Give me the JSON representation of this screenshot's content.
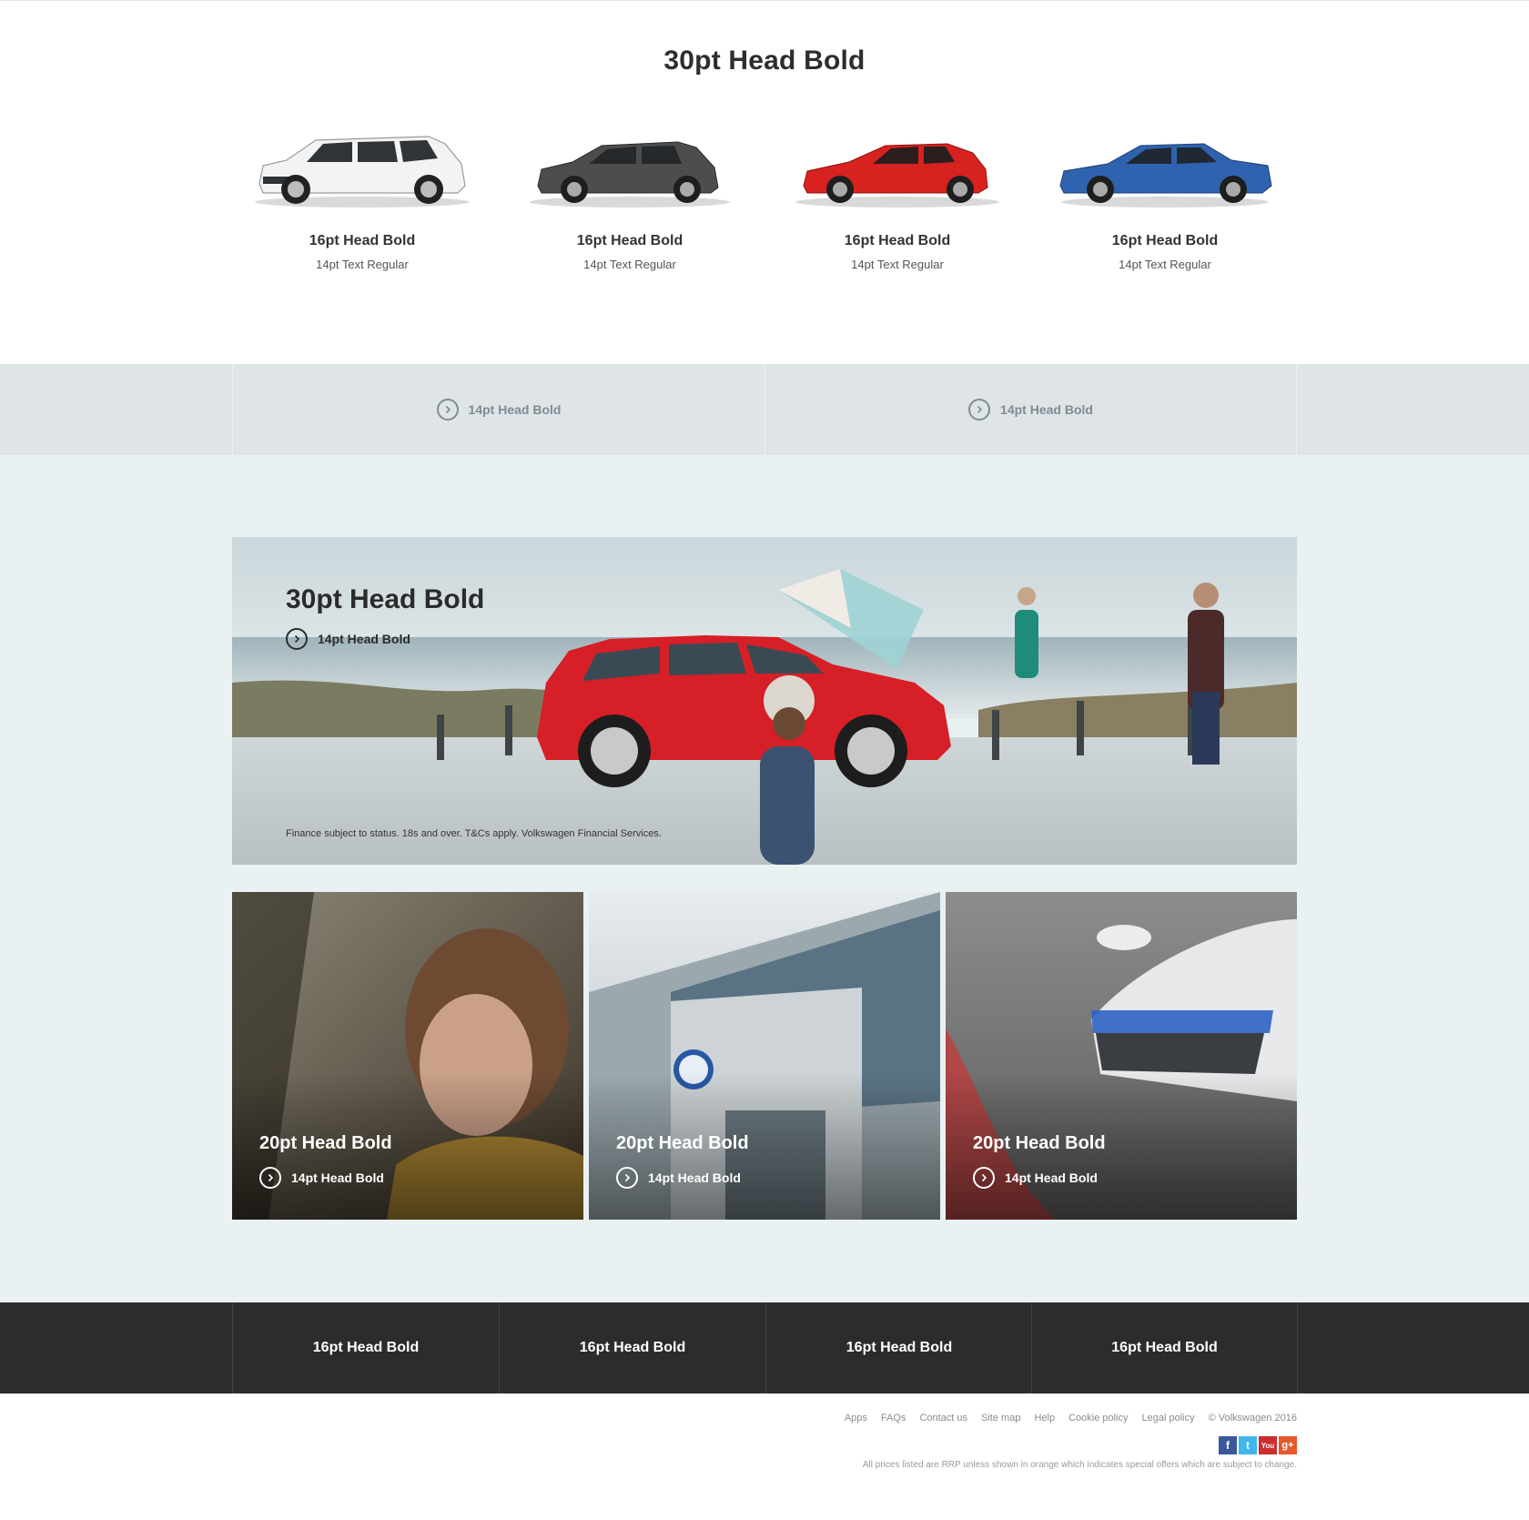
{
  "models": {
    "title": "30pt Head Bold",
    "items": [
      {
        "name": "16pt Head Bold",
        "sub": "14pt Text Regular",
        "color": "#f3f3f3"
      },
      {
        "name": "16pt Head Bold",
        "sub": "14pt Text Regular",
        "color": "#4d4d4d"
      },
      {
        "name": "16pt Head Bold",
        "sub": "14pt Text Regular",
        "color": "#d8221f"
      },
      {
        "name": "16pt Head Bold",
        "sub": "14pt Text Regular",
        "color": "#2f63b0"
      }
    ]
  },
  "link_band": {
    "items": [
      {
        "label": "14pt Head Bold"
      },
      {
        "label": "14pt Head Bold"
      }
    ]
  },
  "hero": {
    "title": "30pt Head Bold",
    "cta": "14pt Head Bold",
    "disclaimer": "Finance subject to status. 18s and over. T&Cs apply. Volkswagen Financial Services."
  },
  "tiles": [
    {
      "title": "20pt Head Bold",
      "cta": "14pt Head Bold"
    },
    {
      "title": "20pt Head Bold",
      "cta": "14pt Head Bold"
    },
    {
      "title": "20pt Head Bold",
      "cta": "14pt Head Bold"
    }
  ],
  "dark_nav": {
    "items": [
      {
        "label": "16pt Head Bold"
      },
      {
        "label": "16pt Head Bold"
      },
      {
        "label": "16pt Head Bold"
      },
      {
        "label": "16pt Head Bold"
      }
    ]
  },
  "footer": {
    "links": [
      "Apps",
      "FAQs",
      "Contact us",
      "Site map",
      "Help",
      "Cookie policy",
      "Legal policy",
      "© Volkswagen 2016"
    ],
    "social": [
      {
        "icon": "facebook-icon",
        "glyph": "f"
      },
      {
        "icon": "twitter-icon",
        "glyph": "t"
      },
      {
        "icon": "youtube-icon",
        "glyph": "You"
      },
      {
        "icon": "google-plus-icon",
        "glyph": "g+"
      }
    ],
    "note": "All prices listed are RRP unless shown in orange which indicates special offers which are subject to change."
  },
  "colors": {
    "accent_link": "#7f8b95",
    "band_bg": "#dfe4e6",
    "teaser_bg": "#eaf1f3",
    "dark_nav_bg": "#2c2c2c"
  }
}
